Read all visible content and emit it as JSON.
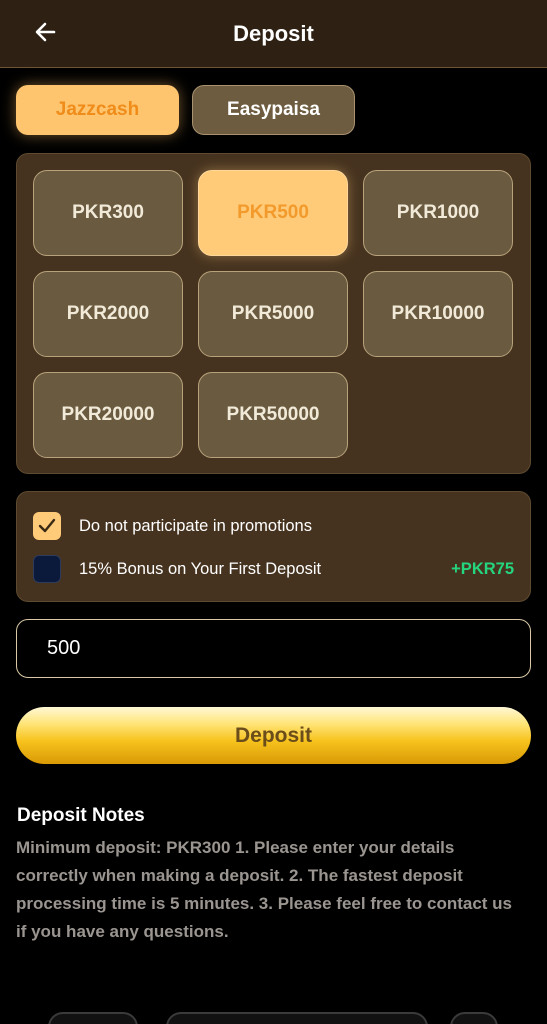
{
  "header": {
    "title": "Deposit",
    "back_icon": "arrow-left-icon"
  },
  "tabs": [
    {
      "label": "Jazzcash",
      "active": true
    },
    {
      "label": "Easypaisa",
      "active": false
    }
  ],
  "amounts": [
    {
      "label": "PKR300",
      "selected": false
    },
    {
      "label": "PKR500",
      "selected": true
    },
    {
      "label": "PKR1000",
      "selected": false
    },
    {
      "label": "PKR2000",
      "selected": false
    },
    {
      "label": "PKR5000",
      "selected": false
    },
    {
      "label": "PKR10000",
      "selected": false
    },
    {
      "label": "PKR20000",
      "selected": false
    },
    {
      "label": "PKR50000",
      "selected": false
    }
  ],
  "promotions": {
    "no_promo": {
      "label": "Do not participate in promotions",
      "checked": true
    },
    "bonus": {
      "label": "15% Bonus on Your First Deposit",
      "amount": "+PKR75",
      "checked": false
    }
  },
  "amount_input": {
    "value": "500"
  },
  "deposit_button": {
    "label": "Deposit"
  },
  "notes": {
    "title": "Deposit Notes",
    "body": "Minimum deposit: PKR300 1. Please enter your details correctly when making a deposit. 2. The fastest deposit processing time is 5 minutes. 3. Please feel free to contact us if you have any questions."
  },
  "colors": {
    "accent": "#ffcb78",
    "accent_text": "#ef8c1a",
    "bonus_green": "#25d57d",
    "panel": "#46331f"
  }
}
